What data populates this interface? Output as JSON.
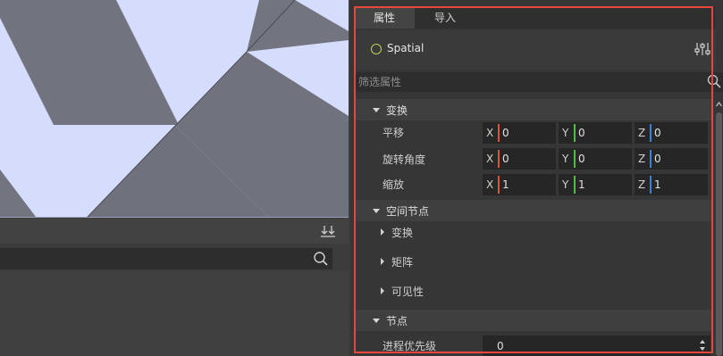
{
  "inspector": {
    "tabs": [
      {
        "label": "属性",
        "active": true
      },
      {
        "label": "导入",
        "active": false
      }
    ],
    "node": {
      "name": "Spatial",
      "icon": "spatial-node-icon"
    },
    "filter": {
      "placeholder": "筛选属性"
    },
    "sections": {
      "transform": {
        "label": "变换",
        "rows": {
          "translation": {
            "label": "平移",
            "x": "0",
            "y": "0",
            "z": "0"
          },
          "rotation": {
            "label": "旋转角度",
            "x": "0",
            "y": "0",
            "z": "0"
          },
          "scale": {
            "label": "缩放",
            "x": "1",
            "y": "1",
            "z": "1"
          }
        }
      },
      "spatial_node": {
        "label": "空间节点",
        "groups": [
          "变换",
          "矩阵",
          "可见性"
        ]
      },
      "node": {
        "label": "节点",
        "process_priority": {
          "label": "进程优先级",
          "value": "0"
        }
      }
    },
    "axes": {
      "x": "X",
      "y": "Y",
      "z": "Z"
    }
  },
  "colors": {
    "highlight": "#e8453b",
    "axis_x": "#d9533f",
    "axis_y": "#54b84a",
    "axis_z": "#3c82d6",
    "spatial_icon": "#b9d25a"
  },
  "icons": [
    "download-icon",
    "search-icon",
    "spatial-node-icon",
    "sliders-icon",
    "scroll-up-icon",
    "spinner-icon"
  ]
}
